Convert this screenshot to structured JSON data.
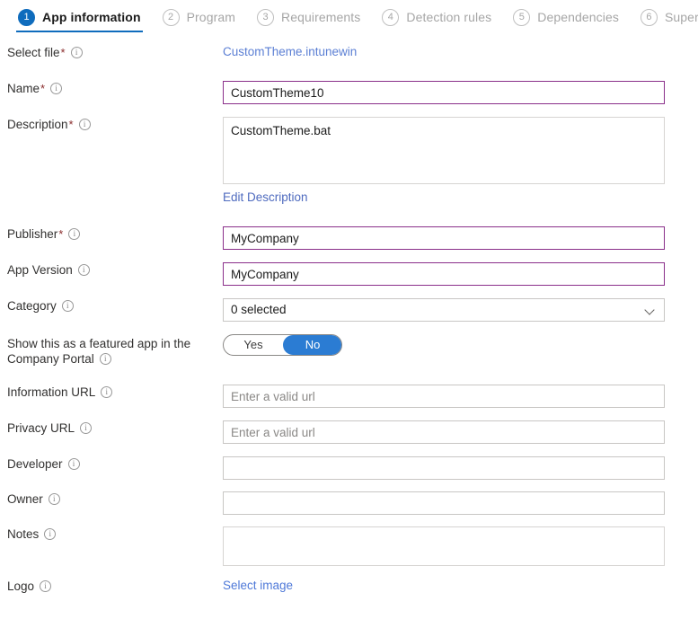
{
  "wizard": {
    "tabs": [
      {
        "number": "1",
        "label": "App information",
        "state": "active"
      },
      {
        "number": "2",
        "label": "Program",
        "state": "inactive"
      },
      {
        "number": "3",
        "label": "Requirements",
        "state": "inactive"
      },
      {
        "number": "4",
        "label": "Detection rules",
        "state": "inactive"
      },
      {
        "number": "5",
        "label": "Dependencies",
        "state": "inactive"
      },
      {
        "number": "6",
        "label": "Supersed",
        "state": "inactive"
      }
    ],
    "accent_color": "#0f6cbd"
  },
  "form": {
    "select_file": {
      "label": "Select file",
      "required": "*",
      "file_link": "CustomTheme.intunewin"
    },
    "name": {
      "label": "Name",
      "required": "*",
      "value": "CustomTheme10",
      "border_color": "#8a2f8a"
    },
    "description": {
      "label": "Description",
      "required": "*",
      "value": "CustomTheme.bat",
      "edit_link": "Edit Description"
    },
    "publisher": {
      "label": "Publisher",
      "required": "*",
      "value": "MyCompany",
      "border_color": "#8a2f8a"
    },
    "app_version": {
      "label": "App Version",
      "value": "MyCompany",
      "border_color": "#8a2f8a"
    },
    "category": {
      "label": "Category",
      "value": "0 selected"
    },
    "featured": {
      "label_line1": "Show this as a featured app in the",
      "label_line2": "Company Portal",
      "option_yes": "Yes",
      "option_no": "No",
      "selected": "No",
      "selected_color": "#2b7cd3"
    },
    "information_url": {
      "label": "Information URL",
      "value": "",
      "placeholder": "Enter a valid url"
    },
    "privacy_url": {
      "label": "Privacy URL",
      "value": "",
      "placeholder": "Enter a valid url"
    },
    "developer": {
      "label": "Developer",
      "value": ""
    },
    "owner": {
      "label": "Owner",
      "value": ""
    },
    "notes": {
      "label": "Notes",
      "value": ""
    },
    "logo": {
      "label": "Logo",
      "select_link": "Select image"
    }
  }
}
